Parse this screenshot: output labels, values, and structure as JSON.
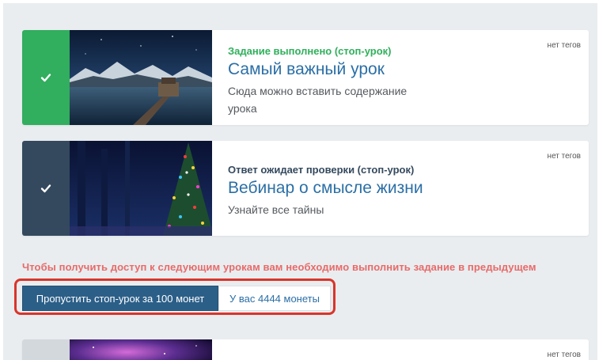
{
  "lessons": [
    {
      "status": "Задание выполнено (стоп-урок)",
      "title": "Самый важный урок",
      "description": "Сюда можно вставить содержание урока",
      "tags": "нет тегов",
      "status_color": "#31ae5e"
    },
    {
      "status": "Ответ ожидает проверки (стоп-урок)",
      "title": "Вебинар о смысле жизни",
      "description": "Узнайте все тайны",
      "tags": "нет тегов",
      "status_color": "#34495e"
    },
    {
      "tags": "нет тегов",
      "status_color": "#d3d8dc"
    }
  ],
  "access_warning": "Чтобы получить доступ к следующим урокам вам необходимо выполнить задание  в предыдущем",
  "skip_button_label": "Пропустить стоп-урок за 100 монет",
  "coins_balance": "У вас 4444 монеты",
  "icons": {
    "status": "check-icon"
  },
  "colors": {
    "warning_text": "#e86a6a",
    "highlight_border": "#d9352b",
    "button": "#2c5f88",
    "link": "#2b6fa6"
  }
}
